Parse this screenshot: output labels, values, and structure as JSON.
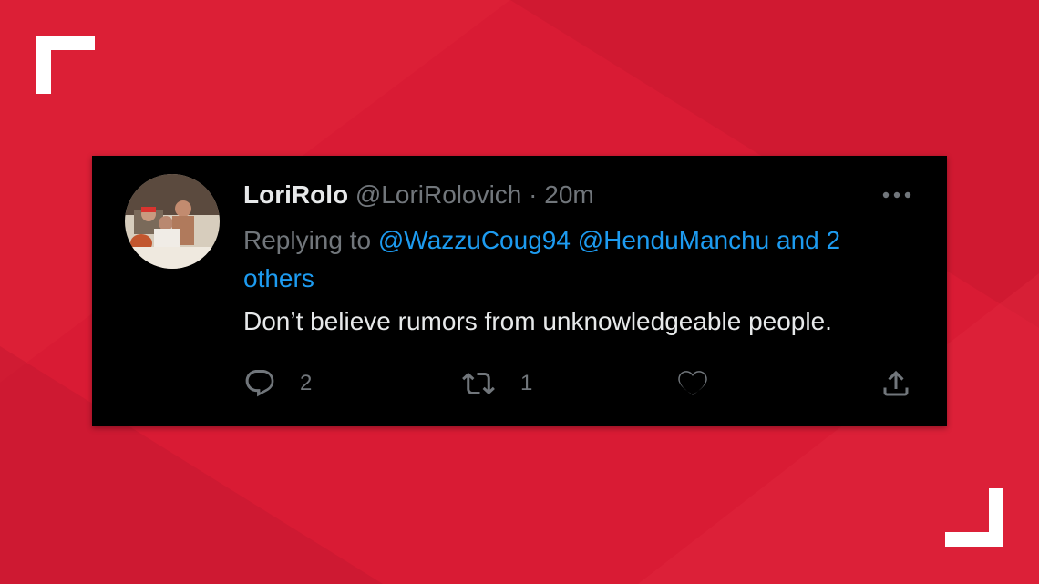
{
  "colors": {
    "background_red": "#d91b34",
    "card_background": "#000000",
    "name_text": "#e7e9ea",
    "secondary_text": "#71767b",
    "link_blue": "#1d9bf0",
    "bracket_white": "#ffffff"
  },
  "tweet": {
    "display_name": "LoriRolo",
    "handle": "@LoriRolovich",
    "separator": "·",
    "time": "20m",
    "reply_prefix": "Replying to",
    "reply_to": {
      "mention_1": "@WazzuCoug94",
      "mention_2": "@HenduManchu",
      "others": "and 2 others"
    },
    "text": "Don’t believe rumors from unknowledgeable people.",
    "actions": {
      "reply_count": "2",
      "retweet_count": "1"
    },
    "icons": {
      "avatar": "avatar-photo",
      "more": "more-dots-icon",
      "reply": "reply-bubble-icon",
      "retweet": "retweet-icon",
      "like": "heart-icon",
      "share": "share-icon"
    }
  }
}
